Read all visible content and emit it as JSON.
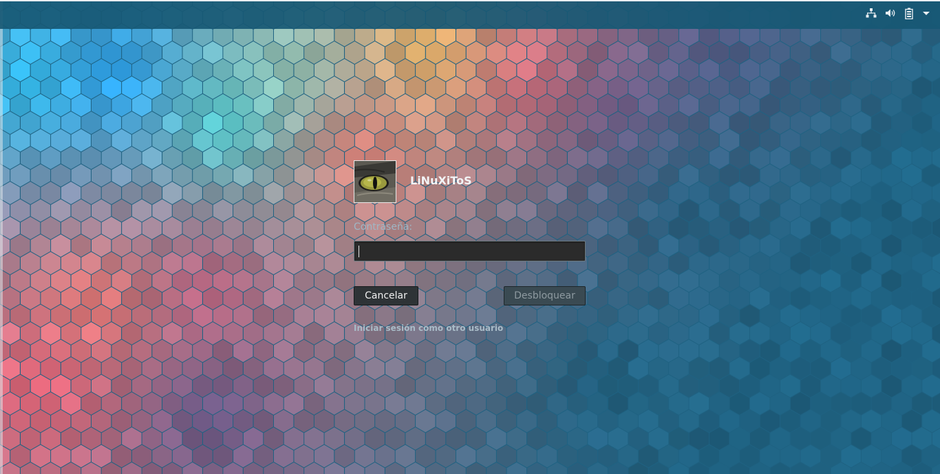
{
  "topbar": {
    "icons": [
      "network-wired-icon",
      "volume-icon",
      "battery-icon",
      "menu-arrow-icon"
    ]
  },
  "login": {
    "avatar": "cat-eye-avatar",
    "username": "LiNuXiToS",
    "password_label": "Contraseña:",
    "password_value": "",
    "cancel_label": "Cancelar",
    "unlock_label": "Desbloquear",
    "other_user_link": "Iniciar sesión como otro usuario"
  },
  "colors": {
    "background": "#1f6282",
    "topbar": "#175874",
    "field": "#2b2b2b",
    "cancel_button": "#2e3336",
    "unlock_button": "#3a4a52"
  }
}
